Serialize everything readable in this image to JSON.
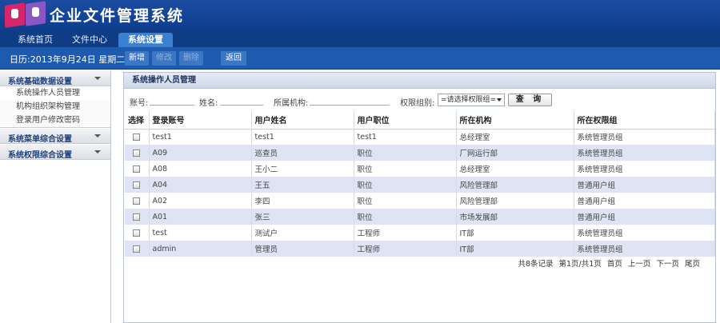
{
  "app": {
    "title": "企业文件管理系统"
  },
  "nav": {
    "tabs": [
      {
        "label": "系统首页"
      },
      {
        "label": "文件中心"
      },
      {
        "label": "系统设置"
      }
    ]
  },
  "toolbar": {
    "date": "日历:2013年9月24日 星期二",
    "add": "新增",
    "edit": "修改",
    "delete": "删除",
    "back": "返回"
  },
  "sidebar": {
    "groups": [
      {
        "title": "系统基础数据设置",
        "items": [
          "系统操作人员管理",
          "机构组织架构管理",
          "登录用户修改密码"
        ]
      },
      {
        "title": "系统菜单综合设置"
      },
      {
        "title": "系统权限综合设置"
      }
    ]
  },
  "panel": {
    "title": "系统操作人员管理"
  },
  "search": {
    "account_label": "账号:",
    "name_label": "姓名:",
    "org_label": "所属机构:",
    "group_label": "权限组别:",
    "group_select": "=请选择权限组=",
    "query_button": "查 询"
  },
  "table": {
    "headers": [
      "选择",
      "登录账号",
      "用户姓名",
      "用户职位",
      "所在机构",
      "所在权限组"
    ],
    "rows": [
      [
        "test1",
        "test1",
        "test1",
        "总经理室",
        "系统管理员组"
      ],
      [
        "A09",
        "巡查员",
        "职位",
        "厂网运行部",
        "系统管理员组"
      ],
      [
        "A08",
        "王小二",
        "职位",
        "总经理室",
        "系统管理员组"
      ],
      [
        "A04",
        "王五",
        "职位",
        "风险管理部",
        "普通用户组"
      ],
      [
        "A02",
        "李四",
        "职位",
        "风险管理部",
        "普通用户组"
      ],
      [
        "A01",
        "张三",
        "职位",
        "市场发展部",
        "普通用户组"
      ],
      [
        "test",
        "测试户",
        "工程师",
        "IT部",
        "系统管理员组"
      ],
      [
        "admin",
        "管理员",
        "工程师",
        "IT部",
        "系统管理员组"
      ]
    ]
  },
  "pager": {
    "total": "共8条记录",
    "page": "第1页/共1页",
    "first": "首页",
    "prev": "上一页",
    "next": "下一页",
    "last": "尾页"
  },
  "colors": {
    "header": "#1b4ca0",
    "row_alt": "#dfe4f4",
    "logo_pink": "#d6266b",
    "logo_purple": "#8a57c6"
  }
}
